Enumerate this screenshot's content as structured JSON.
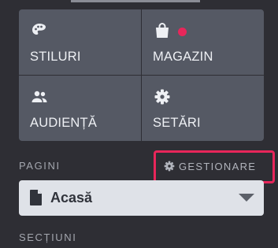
{
  "tiles": [
    {
      "label": "STILURI",
      "icon": "palette-icon"
    },
    {
      "label": "MAGAZIN",
      "icon": "shopping-bag-icon",
      "badge_color": "#e8265a"
    },
    {
      "label": "AUDIENȚĂ",
      "icon": "people-icon"
    },
    {
      "label": "SETĂRI",
      "icon": "gear-icon"
    }
  ],
  "pages": {
    "heading": "PAGINI",
    "manage_label": "GESTIONARE",
    "selected_page": "Acasă",
    "highlight_color": "#e8265a"
  },
  "sections": {
    "heading": "SECȚIUNI"
  }
}
